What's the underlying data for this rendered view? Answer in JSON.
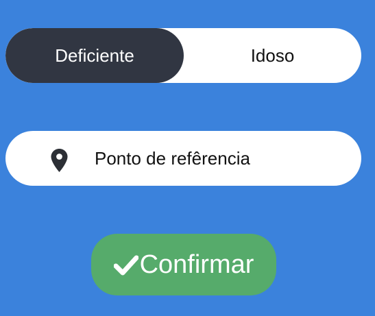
{
  "toggle": {
    "options": [
      {
        "label": "Deficiente",
        "selected": true
      },
      {
        "label": "Idoso",
        "selected": false
      }
    ]
  },
  "reference_field": {
    "icon": "map-marker-icon",
    "placeholder": "Ponto de refêrencia"
  },
  "confirm_button": {
    "icon": "check-icon",
    "label": "Confirmar"
  },
  "colors": {
    "background": "#3b82dc",
    "toggle_active": "#313642",
    "field_background": "#ffffff",
    "confirm_button": "#56ab6b"
  }
}
